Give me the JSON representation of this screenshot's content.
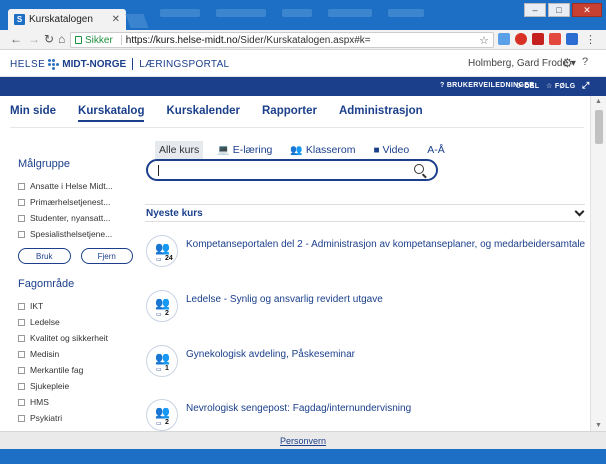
{
  "browser": {
    "tab_title": "Kurskatalogen",
    "secure_label": "Sikker",
    "url_host": "https://kurs.helse-midt.no",
    "url_path": "/Sider/Kurskatalogen.aspx#k="
  },
  "site": {
    "logo_helse": "HELSE",
    "logo_midt": "MIDT-NORGE",
    "logo_portal": "LÆRINGSPORTAL",
    "user_name": "Holmberg, Gard Frode"
  },
  "topbar": {
    "guides": "BRUKERVEILEDNINGER",
    "share": "DEL",
    "follow": "FØLG"
  },
  "nav": [
    {
      "label": "Min side"
    },
    {
      "label": "Kurskatalog"
    },
    {
      "label": "Kurskalender"
    },
    {
      "label": "Rapporter"
    },
    {
      "label": "Administrasjon"
    }
  ],
  "filters": {
    "group_title": "Målgruppe",
    "group_items": [
      "Ansatte i Helse Midt...",
      "Primærhelsetjenest...",
      "Studenter, nyansatt...",
      "Spesialisthelsetjene..."
    ],
    "use_button": "Bruk",
    "remove_button": "Fjern",
    "field_title": "Fagområde",
    "field_items": [
      "IKT",
      "Ledelse",
      "Kvalitet og sikkerheit",
      "Medisin",
      "Merkantile fag",
      "Sjukepleie",
      "HMS",
      "Psykiatri"
    ]
  },
  "course_types": [
    {
      "label": "Alle kurs",
      "icon": ""
    },
    {
      "label": "E-læring",
      "icon": "laptop-icon"
    },
    {
      "label": "Klasserom",
      "icon": "group-icon"
    },
    {
      "label": "Video",
      "icon": "video-camera-icon"
    },
    {
      "label": "A-Å",
      "icon": ""
    }
  ],
  "search": {
    "placeholder": ""
  },
  "newest_label": "Nyeste kurs",
  "courses": [
    {
      "title": "Kompetanseportalen del 2 - Administrasjon av kompetanseplaner, og medarbeidersamtale",
      "count": "24"
    },
    {
      "title": "Ledelse - Synlig og ansvarlig revidert utgave",
      "count": "2"
    },
    {
      "title": "Gynekologisk avdeling, Påskeseminar",
      "count": "1"
    },
    {
      "title": "Nevrologisk sengepost: Fagdag/internundervisning",
      "count": "2"
    }
  ],
  "footer": {
    "privacy": "Personvern"
  },
  "colors": {
    "brand": "#1b3f8b",
    "chrome": "#1c6fc4"
  }
}
